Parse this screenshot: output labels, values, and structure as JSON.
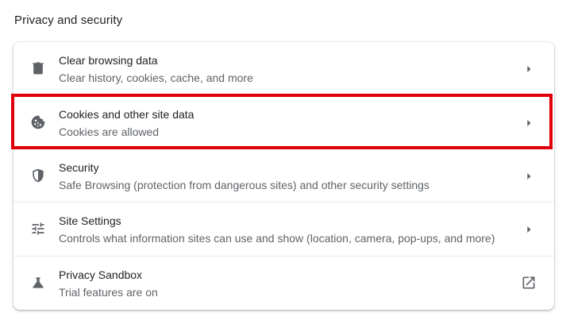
{
  "section": {
    "title": "Privacy and security"
  },
  "rows": [
    {
      "label": "Clear browsing data",
      "sublabel": "Clear history, cookies, cache, and more",
      "icon": "trash-icon",
      "action": "arrow-right-icon"
    },
    {
      "label": "Cookies and other site data",
      "sublabel": "Cookies are allowed",
      "icon": "cookie-icon",
      "action": "arrow-right-icon"
    },
    {
      "label": "Security",
      "sublabel": "Safe Browsing (protection from dangerous sites) and other security settings",
      "icon": "shield-icon",
      "action": "arrow-right-icon"
    },
    {
      "label": "Site Settings",
      "sublabel": "Controls what information sites can use and show (location, camera, pop-ups, and more)",
      "icon": "tune-icon",
      "action": "arrow-right-icon"
    },
    {
      "label": "Privacy Sandbox",
      "sublabel": "Trial features are on",
      "icon": "flask-icon",
      "action": "external-link-icon"
    }
  ],
  "colors": {
    "highlight": "#e0000a",
    "icon": "#5f6368",
    "primary_text": "#202124",
    "secondary_text": "#5f6368"
  }
}
